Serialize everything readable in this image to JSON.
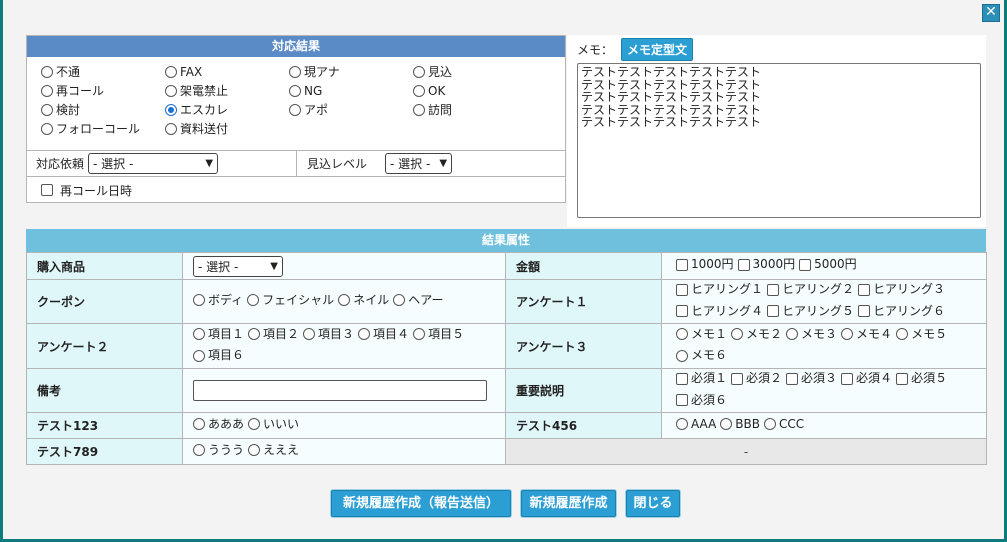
{
  "close_label": "✕",
  "result_panel": {
    "title": "対応結果",
    "options": [
      {
        "label": "不通",
        "selected": false
      },
      {
        "label": "FAX",
        "selected": false
      },
      {
        "label": "現アナ",
        "selected": false
      },
      {
        "label": "見込",
        "selected": false
      },
      {
        "label": "再コール",
        "selected": false
      },
      {
        "label": "架電禁止",
        "selected": false
      },
      {
        "label": "NG",
        "selected": false
      },
      {
        "label": "OK",
        "selected": false
      },
      {
        "label": "検討",
        "selected": false
      },
      {
        "label": "エスカレ",
        "selected": true
      },
      {
        "label": "アポ",
        "selected": false
      },
      {
        "label": "訪問",
        "selected": false
      },
      {
        "label": "フォローコール",
        "selected": false
      },
      {
        "label": "資料送付",
        "selected": false
      }
    ],
    "request_label": "対応依頼",
    "request_value": "- 選択 -",
    "level_label": "見込レベル",
    "level_value": "- 選択 -",
    "recall_label": "再コール日時"
  },
  "memo": {
    "label": "メモ：",
    "template_button": "メモ定型文",
    "text": "テストテストテストテストテスト\nテストテストテストテストテスト\nテストテストテストテストテスト\nテストテストテストテストテスト\nテストテストテストテストテスト"
  },
  "attributes": {
    "title": "結果属性",
    "product_label": "購入商品",
    "product_value": "- 選択 -",
    "amount_label": "金額",
    "amount_options": [
      "1000円",
      "3000円",
      "5000円"
    ],
    "coupon_label": "クーポン",
    "coupon_options": [
      "ボディ",
      "フェイシャル",
      "ネイル",
      "ヘアー"
    ],
    "survey1_label": "アンケート１",
    "survey1_options": [
      "ヒアリング１",
      "ヒアリング２",
      "ヒアリング３",
      "ヒアリング４",
      "ヒアリング５",
      "ヒアリング６"
    ],
    "survey2_label": "アンケート２",
    "survey2_options": [
      "項目１",
      "項目２",
      "項目３",
      "項目４",
      "項目５",
      "項目６"
    ],
    "survey3_label": "アンケート３",
    "survey3_options": [
      "メモ１",
      "メモ２",
      "メモ３",
      "メモ４",
      "メモ５",
      "メモ６"
    ],
    "notes_label": "備考",
    "notes_value": "",
    "important_label": "重要説明",
    "important_options": [
      "必須１",
      "必須２",
      "必須３",
      "必須４",
      "必須５",
      "必須６"
    ],
    "test123_label": "テスト123",
    "test123_options": [
      "あああ",
      "いいい"
    ],
    "test456_label": "テスト456",
    "test456_options": [
      "AAA",
      "BBB",
      "CCC"
    ],
    "test789_label": "テスト789",
    "test789_options": [
      "ううう",
      "えええ"
    ],
    "empty_cell": "-"
  },
  "buttons": {
    "create_report": "新規履歴作成（報告送信）",
    "create": "新規履歴作成",
    "close": "閉じる"
  },
  "colors": {
    "panel_header": "#5a8bc7",
    "attr_header": "#6ec0dc",
    "button": "#2b9fd4",
    "frame_border": "#0f7b7d",
    "label_cell": "#e0f7f9"
  }
}
